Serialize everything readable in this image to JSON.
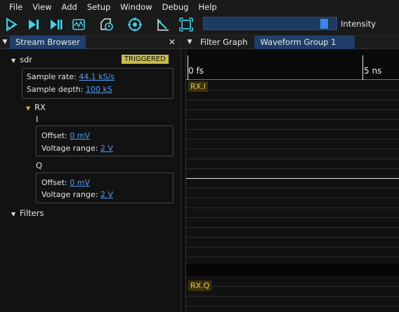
{
  "menu": [
    "File",
    "View",
    "Add",
    "Setup",
    "Window",
    "Debug",
    "Help"
  ],
  "toolbar": {
    "intensity_label": "Intensity",
    "intensity_value": 0.93,
    "icons": [
      "start-icon",
      "start-single-icon",
      "start-continuous-icon",
      "stop-icon",
      "fft-icon",
      "history-icon",
      "reset-icon",
      "cursor-icon",
      "fullscreen-icon"
    ]
  },
  "stream_browser": {
    "tab_label": "Stream Browser",
    "device": {
      "name": "sdr",
      "status": "TRIGGERED",
      "sample_rate_label": "Sample rate:",
      "sample_rate_value": "44.1 kS/s",
      "sample_depth_label": "Sample depth:",
      "sample_depth_value": "100 kS"
    },
    "channel": {
      "name": "RX",
      "streams": [
        {
          "name": "I",
          "offset_label": "Offset:",
          "offset_value": "0 mV",
          "range_label": "Voltage range:",
          "range_value": "2 V"
        },
        {
          "name": "Q",
          "offset_label": "Offset:",
          "offset_value": "0 mV",
          "range_label": "Voltage range:",
          "range_value": "2 V"
        }
      ]
    },
    "filters_label": "Filters"
  },
  "waveform_panel": {
    "tabs": [
      "Filter Graph",
      "Waveform Group 1"
    ],
    "ruler_labels": [
      "0 fs",
      "5 ns"
    ],
    "traces": [
      "RX.I",
      "RX.Q"
    ]
  }
}
